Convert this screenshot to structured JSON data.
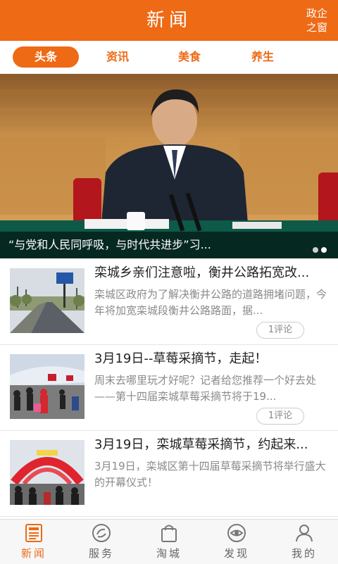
{
  "header": {
    "title": "新闻",
    "corner_line1": "政企",
    "corner_line2": "之窗"
  },
  "tabs": [
    {
      "label": "头条",
      "active": true
    },
    {
      "label": "资讯",
      "active": false
    },
    {
      "label": "美食",
      "active": false
    },
    {
      "label": "养生",
      "active": false
    }
  ],
  "banner": {
    "caption": "“与党和人民同呼吸，与时代共进步”习...",
    "slide_count": 2,
    "active_slide": 2
  },
  "news": [
    {
      "title": "栾城乡亲们注意啦，衡井公路拓宽改...",
      "desc": "栾城区政府为了解决衡井公路的道路拥堵问题，今年将加宽栾城段衡井公路路面，据...",
      "comments": "1评论"
    },
    {
      "title": "3月19日--草莓采摘节，走起！",
      "desc": "周末去哪里玩才好呢？记者给您推荐一个好去处——第十四届栾城草莓采摘节将于19...",
      "comments": "1评论"
    },
    {
      "title": "3月19日，栾城草莓采摘节，约起来...",
      "desc": "3月19日，栾城区第十四届草莓采摘节将举行盛大的开幕仪式！",
      "comments": ""
    }
  ],
  "bottom_nav": [
    {
      "label": "新闻",
      "icon": "newspaper-icon",
      "active": true
    },
    {
      "label": "服务",
      "icon": "service-icon",
      "active": false
    },
    {
      "label": "淘城",
      "icon": "shopping-bag-icon",
      "active": false
    },
    {
      "label": "发现",
      "icon": "discover-eye-icon",
      "active": false
    },
    {
      "label": "我的",
      "icon": "user-icon",
      "active": false
    }
  ],
  "colors": {
    "accent": "#ee6a15",
    "text_dark": "#222222",
    "text_gray": "#8a8a8a",
    "nav_bg": "#f7f7f7"
  }
}
